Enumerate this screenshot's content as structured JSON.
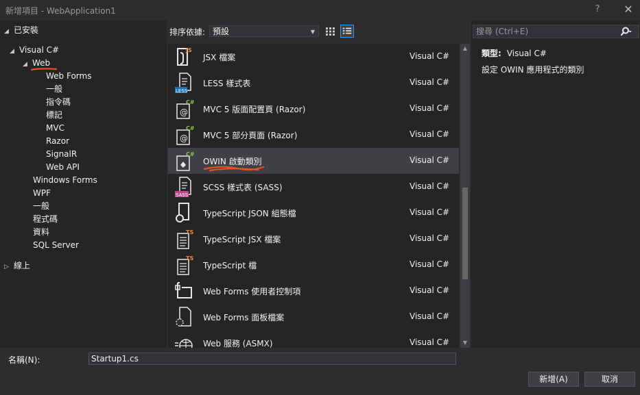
{
  "window": {
    "title": "新增項目 - WebApplication1",
    "help": "?",
    "close": "✕"
  },
  "tree": {
    "installed": "已安裝",
    "visual_csharp": "Visual C#",
    "web": "Web",
    "web_children": [
      "Web Forms",
      "一般",
      "指令碼",
      "標記",
      "MVC",
      "Razor",
      "SignalR",
      "Web API"
    ],
    "siblings": [
      "Windows Forms",
      "WPF",
      "一般",
      "程式碼",
      "資料",
      "SQL Server"
    ],
    "online": "線上"
  },
  "toolbar": {
    "sort_label": "排序依據:",
    "sort_value": "預設"
  },
  "search": {
    "placeholder": "搜尋 (Ctrl+E)"
  },
  "items": [
    {
      "name": "JSX 檔案",
      "lang": "Visual C#",
      "badge": "JS"
    },
    {
      "name": "LESS 樣式表",
      "lang": "Visual C#",
      "badge": "LESS"
    },
    {
      "name": "MVC 5 版面配置頁 (Razor)",
      "lang": "Visual C#",
      "badge": "C#"
    },
    {
      "name": "MVC 5 部分頁面 (Razor)",
      "lang": "Visual C#",
      "badge": "C#"
    },
    {
      "name": "OWIN 啟動類別",
      "lang": "Visual C#",
      "badge": "C#"
    },
    {
      "name": "SCSS 樣式表 (SASS)",
      "lang": "Visual C#",
      "badge": "SASS"
    },
    {
      "name": "TypeScript JSON 組態檔",
      "lang": "Visual C#",
      "badge": ""
    },
    {
      "name": "TypeScript JSX 檔案",
      "lang": "Visual C#",
      "badge": "TS"
    },
    {
      "name": "TypeScript 檔",
      "lang": "Visual C#",
      "badge": "TS"
    },
    {
      "name": "Web Forms 使用者控制項",
      "lang": "Visual C#",
      "badge": ""
    },
    {
      "name": "Web Forms 面板檔案",
      "lang": "Visual C#",
      "badge": ""
    },
    {
      "name": "Web 服務 (ASMX)",
      "lang": "Visual C#",
      "badge": ""
    }
  ],
  "details": {
    "type_label": "類型:",
    "type_value": "Visual C#",
    "description": "設定 OWIN 應用程式的類別"
  },
  "footer": {
    "name_label": "名稱(N):",
    "name_value": "Startup1.cs",
    "add_button": "新增(A)",
    "cancel_button": "取消"
  },
  "colors": {
    "background": "#2d2d30",
    "pane": "#252526",
    "selection": "#3f3f46",
    "csharp_badge": "#8bc34a",
    "ts_badge": "#f0883e",
    "less_badge": "#1e6fb8",
    "sass_badge": "#c4458a",
    "annotation": "#e8501f"
  }
}
